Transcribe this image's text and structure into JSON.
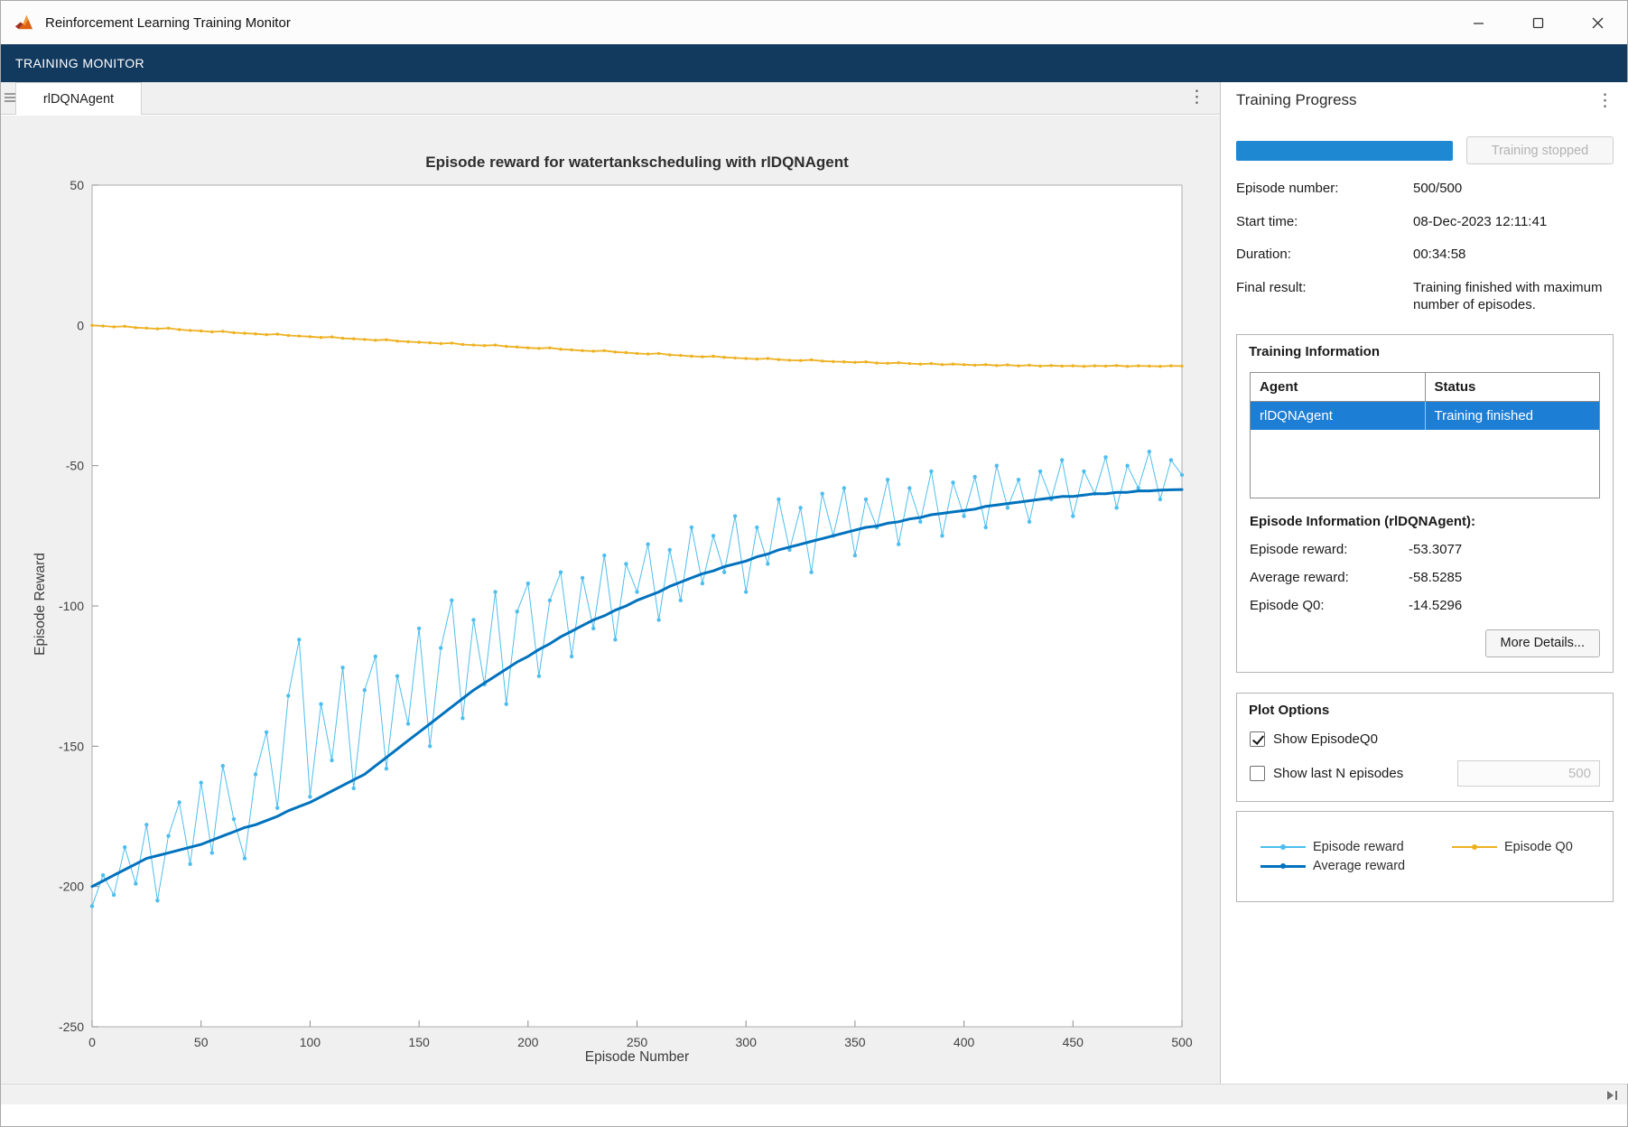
{
  "window": {
    "title": "Reinforcement Learning Training Monitor"
  },
  "toolstrip": {
    "label": "TRAINING MONITOR"
  },
  "tab": {
    "label": "rlDQNAgent"
  },
  "icons": {
    "kebab_menu": "⋮"
  },
  "colors": {
    "accent_blue": "#1e88d2",
    "selection_blue": "#1d7ed6",
    "toolstrip_navy": "#12395e"
  },
  "training_progress": {
    "title": "Training Progress",
    "stop_button_label": "Training stopped",
    "progress_percent": 100,
    "fields": [
      {
        "label": "Episode number:",
        "value": "500/500"
      },
      {
        "label": "Start time:",
        "value": "08-Dec-2023 12:11:41"
      },
      {
        "label": "Duration:",
        "value": "00:34:58"
      },
      {
        "label": "Final result:",
        "value": "Training finished with maximum number of episodes."
      }
    ]
  },
  "training_information": {
    "title": "Training Information",
    "table": {
      "headers": [
        "Agent",
        "Status"
      ],
      "rows": [
        [
          "rlDQNAgent",
          "Training finished"
        ]
      ]
    },
    "episode_title": "Episode Information (rlDQNAgent):",
    "fields": [
      {
        "label": "Episode reward:",
        "value": "-53.3077"
      },
      {
        "label": "Average reward:",
        "value": "-58.5285"
      },
      {
        "label": "Episode Q0:",
        "value": "-14.5296"
      }
    ],
    "more_details_label": "More Details..."
  },
  "plot_options": {
    "title": "Plot Options",
    "show_episode_q0": {
      "label": "Show EpisodeQ0",
      "checked": true
    },
    "show_last_n": {
      "label": "Show last N episodes",
      "checked": false,
      "value": "500"
    }
  },
  "legend": {
    "entries": [
      {
        "label": "Episode reward",
        "color": "#4DBEEE",
        "line_width": 2
      },
      {
        "label": "Episode Q0",
        "color": "#EDB120",
        "line_width": 2
      },
      {
        "label": "Average reward",
        "color": "#0072BD",
        "line_width": 3
      }
    ]
  },
  "chart_data": {
    "type": "line",
    "title": "Episode reward for watertankscheduling with rlDQNAgent",
    "xlabel": "Episode Number",
    "ylabel": "Episode Reward",
    "xlim": [
      0,
      500
    ],
    "ylim": [
      -250,
      50
    ],
    "xticks": [
      0,
      50,
      100,
      150,
      200,
      250,
      300,
      350,
      400,
      450,
      500
    ],
    "yticks": [
      -250,
      -200,
      -150,
      -100,
      -50,
      0,
      50
    ],
    "grid": false,
    "legend_position": "right-panel",
    "x_start": 0,
    "x_step": 5,
    "series": [
      {
        "name": "Episode reward",
        "color": "#4DBEEE",
        "line_width": 1,
        "marker_size": 2.2,
        "values": [
          -207,
          -196,
          -203,
          -186,
          -199,
          -178,
          -205,
          -182,
          -170,
          -192,
          -163,
          -188,
          -157,
          -176,
          -190,
          -160,
          -145,
          -172,
          -132,
          -112,
          -168,
          -135,
          -155,
          -122,
          -165,
          -130,
          -118,
          -158,
          -125,
          -142,
          -108,
          -150,
          -115,
          -98,
          -140,
          -105,
          -128,
          -95,
          -135,
          -102,
          -92,
          -125,
          -98,
          -88,
          -118,
          -90,
          -108,
          -82,
          -112,
          -85,
          -95,
          -78,
          -105,
          -80,
          -98,
          -72,
          -92,
          -75,
          -88,
          -68,
          -95,
          -72,
          -85,
          -62,
          -80,
          -65,
          -88,
          -60,
          -75,
          -58,
          -82,
          -62,
          -72,
          -55,
          -78,
          -58,
          -70,
          -52,
          -75,
          -56,
          -68,
          -54,
          -72,
          -50,
          -65,
          -55,
          -70,
          -52,
          -62,
          -48,
          -68,
          -52,
          -60,
          -47,
          -65,
          -50,
          -58,
          -45,
          -62,
          -48,
          -53.3
        ]
      },
      {
        "name": "Average reward",
        "color": "#0072BD",
        "line_width": 3,
        "marker_size": 0,
        "values": [
          -200,
          -198,
          -196,
          -194,
          -192,
          -190,
          -189,
          -188,
          -187,
          -186,
          -185,
          -183.5,
          -182,
          -180.5,
          -179,
          -178,
          -176.5,
          -175,
          -173,
          -171.5,
          -170,
          -168,
          -166,
          -164,
          -162,
          -160,
          -157,
          -154,
          -151,
          -148,
          -145,
          -142,
          -139,
          -136,
          -133,
          -130,
          -127.5,
          -125,
          -122.5,
          -120,
          -118,
          -115.5,
          -113.5,
          -111,
          -109,
          -107,
          -105,
          -103.5,
          -101.5,
          -100,
          -98,
          -96.5,
          -95,
          -93,
          -91.5,
          -90,
          -88.5,
          -87.5,
          -86,
          -85,
          -84,
          -82.5,
          -81.5,
          -80,
          -79,
          -78,
          -77,
          -76,
          -75,
          -74,
          -73,
          -72,
          -71.5,
          -70.5,
          -70,
          -69,
          -68.5,
          -67.5,
          -67,
          -66.5,
          -66,
          -65.5,
          -64.5,
          -64,
          -63.5,
          -63,
          -62.5,
          -62,
          -61.5,
          -61,
          -61,
          -60.5,
          -60,
          -60,
          -59.5,
          -59.5,
          -59,
          -59,
          -58.7,
          -58.6,
          -58.5
        ]
      },
      {
        "name": "Episode Q0",
        "color": "#EDB120",
        "line_width": 1.8,
        "marker_size": 1.7,
        "values": [
          0,
          -0.2,
          -0.5,
          -0.3,
          -0.8,
          -1,
          -1.2,
          -1,
          -1.5,
          -1.8,
          -2,
          -2.3,
          -2.1,
          -2.6,
          -2.8,
          -3,
          -3.3,
          -3.1,
          -3.6,
          -3.8,
          -4,
          -4.3,
          -4.1,
          -4.6,
          -4.8,
          -5,
          -5.3,
          -5.1,
          -5.6,
          -5.8,
          -6,
          -6.2,
          -6.5,
          -6.3,
          -6.8,
          -7,
          -7.2,
          -7,
          -7.5,
          -7.7,
          -8,
          -8.2,
          -8,
          -8.5,
          -8.7,
          -9,
          -9.2,
          -9,
          -9.5,
          -9.7,
          -10,
          -10.2,
          -10,
          -10.5,
          -10.7,
          -11,
          -11.2,
          -11,
          -11.4,
          -11.6,
          -11.8,
          -12,
          -11.8,
          -12.2,
          -12.4,
          -12.5,
          -12.3,
          -12.7,
          -12.9,
          -13,
          -13.2,
          -13,
          -13.4,
          -13.5,
          -13.3,
          -13.6,
          -13.8,
          -13.6,
          -14,
          -13.8,
          -14,
          -14.2,
          -14,
          -14.3,
          -14.1,
          -14.4,
          -14.2,
          -14.5,
          -14.3,
          -14.5,
          -14.4,
          -14.6,
          -14.4,
          -14.5,
          -14.3,
          -14.6,
          -14.4,
          -14.5,
          -14.6,
          -14.4,
          -14.5
        ]
      }
    ]
  }
}
